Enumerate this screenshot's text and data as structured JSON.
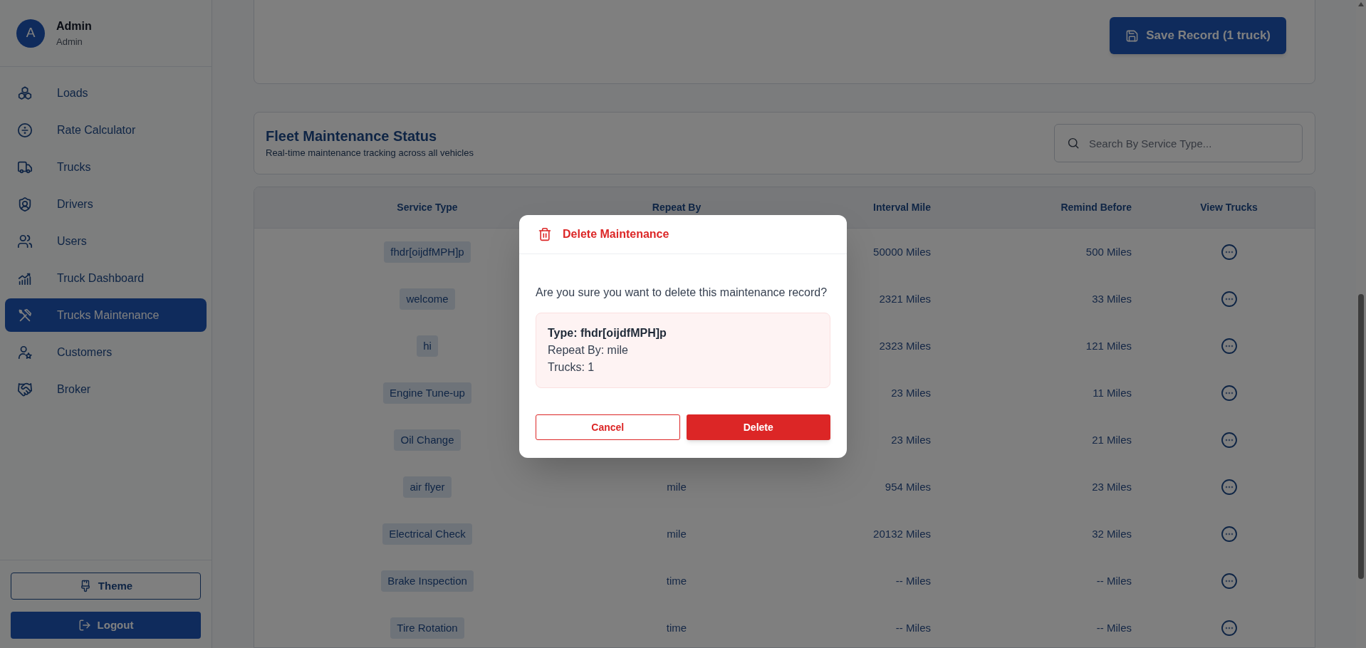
{
  "sidebar": {
    "user": {
      "initial": "A",
      "name": "Admin",
      "role": "Admin"
    },
    "items": [
      {
        "label": "Loads",
        "selected": false
      },
      {
        "label": "Rate Calculator",
        "selected": false
      },
      {
        "label": "Trucks",
        "selected": false
      },
      {
        "label": "Drivers",
        "selected": false
      },
      {
        "label": "Users",
        "selected": false
      },
      {
        "label": "Truck Dashboard",
        "selected": false
      },
      {
        "label": "Trucks Maintenance",
        "selected": true
      },
      {
        "label": "Customers",
        "selected": false
      },
      {
        "label": "Broker",
        "selected": false
      }
    ],
    "footer_buttons": [
      {
        "label": "Theme",
        "kind": "outline"
      },
      {
        "label": "Logout",
        "kind": "primary"
      }
    ]
  },
  "record_form": {
    "save_button": "Save Record (1 truck)"
  },
  "fleet_panel": {
    "title": "Fleet Maintenance Status",
    "subtitle": "Real-time maintenance tracking across all vehicles",
    "search": {
      "placeholder": "Search By Service Type..."
    }
  },
  "table": {
    "columns": [
      "Service Type",
      "Repeat By",
      "Interval Mile",
      "Remind Before",
      "View Trucks"
    ],
    "rows": [
      {
        "service_type": "fhdr[oijdfMPH]p",
        "interval_mile": "50000 Miles",
        "remind_before": "500 Miles"
      },
      {
        "service_type": "welcome",
        "interval_mile": "2321 Miles",
        "remind_before": "33 Miles"
      },
      {
        "service_type": "hi",
        "interval_mile": "2323 Miles",
        "remind_before": "121 Miles"
      },
      {
        "service_type": "Engine Tune-up",
        "interval_mile": "23 Miles",
        "remind_before": "11 Miles"
      },
      {
        "service_type": "Oil Change",
        "interval_mile": "23 Miles",
        "remind_before": "21 Miles"
      },
      {
        "service_type": "air flyer",
        "repeat_by": "mile",
        "interval_mile": "954 Miles",
        "remind_before": "23 Miles"
      },
      {
        "service_type": "Electrical Check",
        "repeat_by": "mile",
        "interval_mile": "20132 Miles",
        "remind_before": "32 Miles"
      },
      {
        "service_type": "Brake Inspection",
        "repeat_by": "time",
        "interval_mile": "-- Miles",
        "remind_before": "-- Miles"
      },
      {
        "service_type": "Tire Rotation",
        "repeat_by": "time",
        "interval_mile": "-- Miles",
        "remind_before": "-- Miles"
      }
    ]
  },
  "dialog": {
    "title": "Delete Maintenance",
    "message": "Are you sure you want to delete this maintenance record?",
    "details": [
      {
        "text": "Type: fhdr[oijdfMPH]p",
        "kind": "heading"
      },
      {
        "text": "Repeat By: mile",
        "kind": "line"
      },
      {
        "text": "Trucks: 1",
        "kind": "line"
      }
    ],
    "buttons": [
      {
        "label": "Cancel",
        "kind": "outline"
      },
      {
        "label": "Delete",
        "kind": "danger"
      }
    ]
  }
}
